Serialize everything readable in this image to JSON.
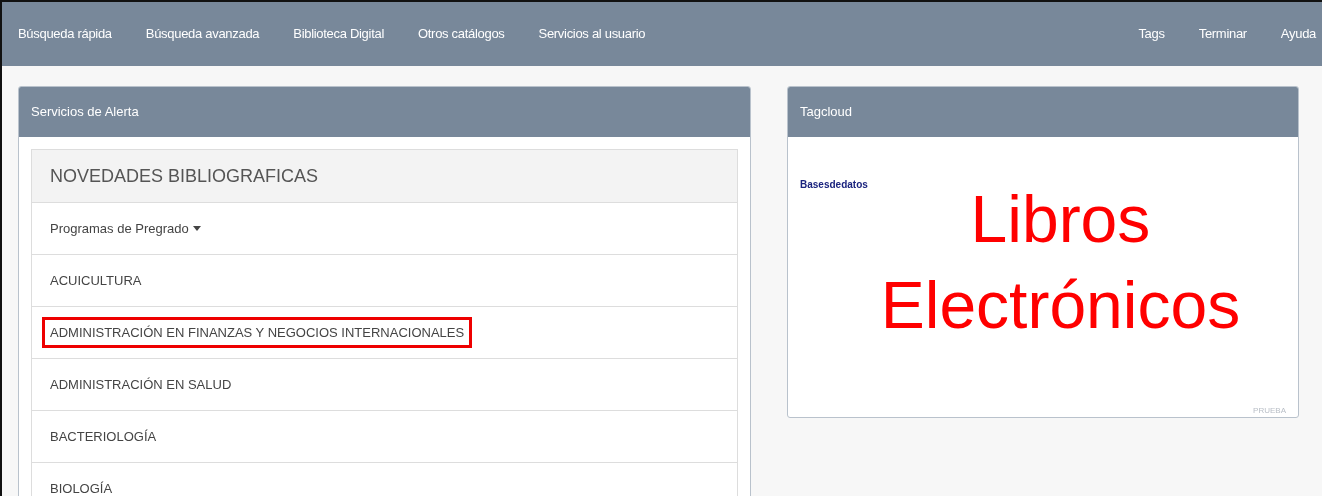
{
  "nav": {
    "left": [
      {
        "label": "Búsqueda rápida"
      },
      {
        "label": "Búsqueda avanzada"
      },
      {
        "label": "Biblioteca Digital"
      },
      {
        "label": "Otros catálogos"
      },
      {
        "label": "Servicios al usuario"
      }
    ],
    "right": [
      {
        "label": "Tags"
      },
      {
        "label": "Terminar"
      },
      {
        "label": "Ayuda"
      }
    ]
  },
  "alerts": {
    "title": "Servicios de Alerta",
    "list_title": "NOVEDADES BIBLIOGRAFICAS",
    "dropdown": "Programas de Pregrado",
    "items": [
      {
        "label": "ACUICULTURA",
        "highlighted": false
      },
      {
        "label": "ADMINISTRACIÓN EN FINANZAS Y NEGOCIOS INTERNACIONALES",
        "highlighted": true
      },
      {
        "label": "ADMINISTRACIÓN EN SALUD",
        "highlighted": false
      },
      {
        "label": "BACTERIOLOGÍA",
        "highlighted": false
      },
      {
        "label": "BIOLOGÍA",
        "highlighted": false
      }
    ]
  },
  "tagcloud": {
    "title": "Tagcloud",
    "tags": [
      {
        "label": "Basesdedatos",
        "kind": "small",
        "color": "#1a237e"
      },
      {
        "label": "Libros Electrónicos",
        "kind": "large",
        "color": "#ff0000"
      },
      {
        "label": "PRUEBA",
        "kind": "tiny",
        "color": "#b8bec6"
      }
    ]
  }
}
